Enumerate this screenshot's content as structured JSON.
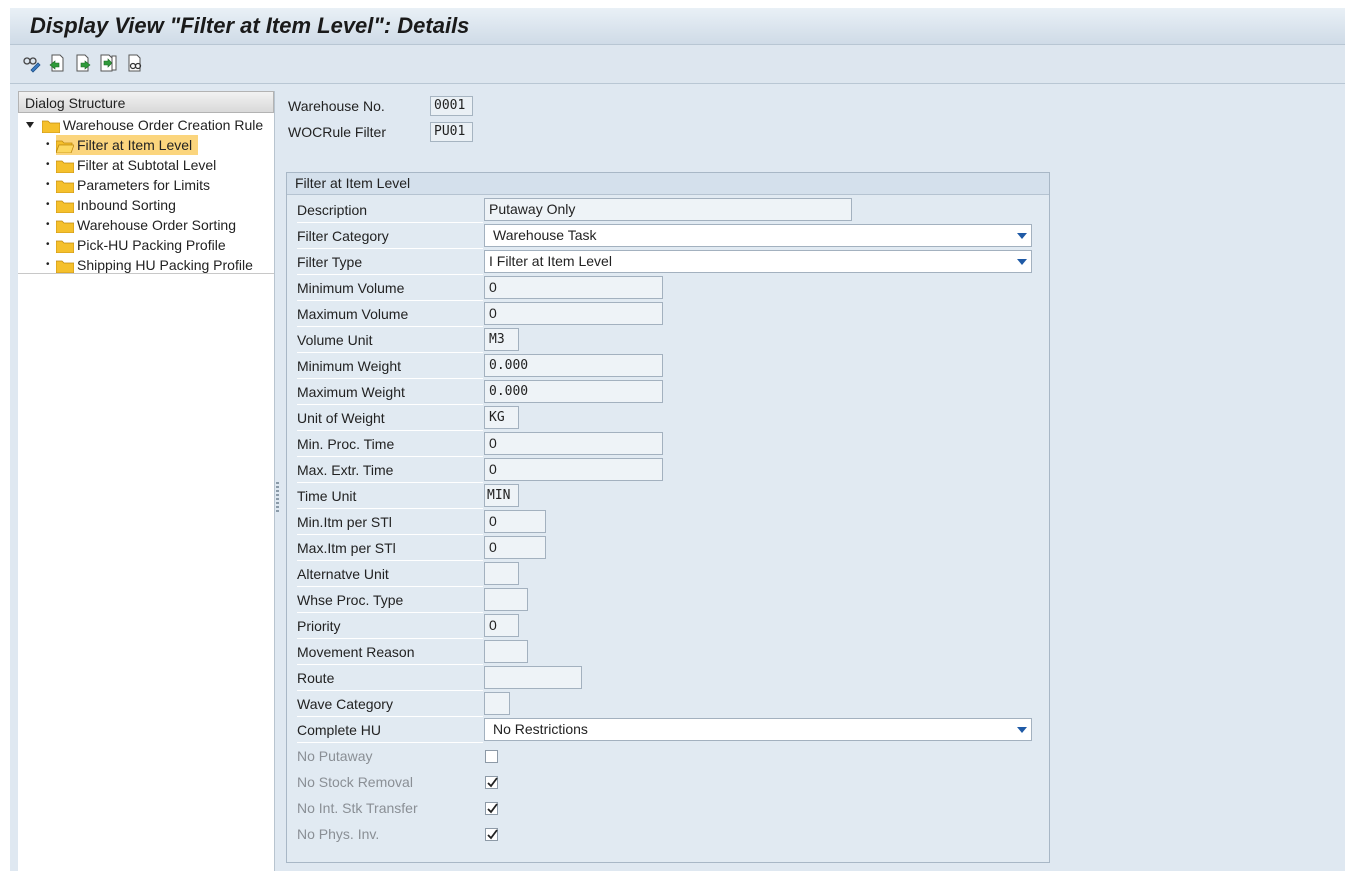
{
  "window": {
    "title": "Display View \"Filter at Item Level\": Details"
  },
  "toolbar": {
    "buttons": [
      {
        "icon": "glasses-edit-icon"
      },
      {
        "icon": "previous-entry-icon"
      },
      {
        "icon": "next-entry-icon"
      },
      {
        "icon": "other-entry-icon"
      },
      {
        "icon": "find-icon"
      }
    ]
  },
  "dialog_structure": {
    "header": "Dialog Structure",
    "root": "Warehouse Order Creation Rule",
    "items": [
      {
        "label": "Filter at Item Level",
        "selected": true
      },
      {
        "label": "Filter at Subtotal Level"
      },
      {
        "label": "Parameters for Limits"
      },
      {
        "label": "Inbound Sorting"
      },
      {
        "label": "Warehouse Order Sorting"
      },
      {
        "label": "Pick-HU Packing Profile"
      },
      {
        "label": "Shipping HU Packing Profile"
      }
    ]
  },
  "header": {
    "warehouse_label": "Warehouse No.",
    "warehouse_value": "0001",
    "wocrule_label": "WOCRule Filter",
    "wocrule_value": "PU01"
  },
  "group": {
    "title": "Filter at Item Level",
    "fields": {
      "description": {
        "label": "Description",
        "value": "Putaway Only"
      },
      "filter_category": {
        "label": "Filter Category",
        "value": "Warehouse Task"
      },
      "filter_type": {
        "label": "Filter Type",
        "value": "I Filter at Item Level"
      },
      "min_volume": {
        "label": "Minimum Volume",
        "value": "0"
      },
      "max_volume": {
        "label": "Maximum Volume",
        "value": "0"
      },
      "volume_unit": {
        "label": "Volume Unit",
        "value": "M3"
      },
      "min_weight": {
        "label": "Minimum Weight",
        "value": "0.000"
      },
      "max_weight": {
        "label": "Maximum Weight",
        "value": "0.000"
      },
      "unit_weight": {
        "label": "Unit of Weight",
        "value": "KG"
      },
      "min_proc_time": {
        "label": "Min. Proc. Time",
        "value": "0"
      },
      "max_extr_time": {
        "label": "Max. Extr. Time",
        "value": "0"
      },
      "time_unit": {
        "label": "Time Unit",
        "value": "MIN"
      },
      "min_itm_stl": {
        "label": "Min.Itm per STl",
        "value": "0"
      },
      "max_itm_stl": {
        "label": "Max.Itm per STl",
        "value": "0"
      },
      "alt_unit": {
        "label": "Alternatve Unit",
        "value": ""
      },
      "whse_proc_type": {
        "label": "Whse Proc. Type",
        "value": ""
      },
      "priority": {
        "label": "Priority",
        "value": "0"
      },
      "movement_reason": {
        "label": "Movement Reason",
        "value": ""
      },
      "route": {
        "label": "Route",
        "value": ""
      },
      "wave_category": {
        "label": "Wave Category",
        "value": ""
      },
      "complete_hu": {
        "label": "Complete HU",
        "value": "No Restrictions"
      }
    },
    "checkboxes": {
      "no_putaway": {
        "label": "No Putaway",
        "checked": false
      },
      "no_stock_removal": {
        "label": "No Stock Removal",
        "checked": true
      },
      "no_int_stk_transfer": {
        "label": "No Int. Stk Transfer",
        "checked": true
      },
      "no_phys_inv": {
        "label": "No Phys. Inv.",
        "checked": true
      }
    }
  }
}
